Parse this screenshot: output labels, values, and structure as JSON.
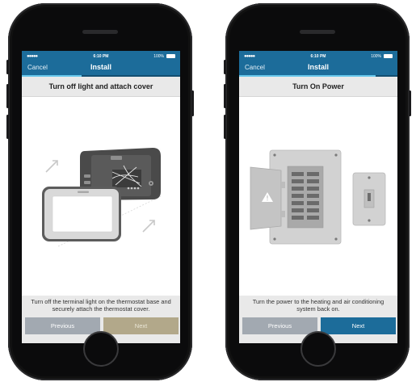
{
  "status_bar": {
    "signal": "●●●●●",
    "time": "6:10 PM",
    "battery": "100%"
  },
  "screens": [
    {
      "nav": {
        "cancel": "Cancel",
        "title": "Install"
      },
      "progress": 0.38,
      "step_title": "Turn off light and attach cover",
      "instruction": "Turn off the terminal light on the thermostat base and securely attach the thermostat cover.",
      "buttons": {
        "previous": "Previous",
        "next": "Next"
      },
      "illustration_icons": [
        "thermostat-base-icon",
        "thermostat-cover-icon",
        "arrow-icon"
      ],
      "next_state": "disabled"
    },
    {
      "nav": {
        "cancel": "Cancel",
        "title": "Install"
      },
      "progress": 0.86,
      "step_title": "Turn On Power",
      "instruction": "Turn the power to the heating and air conditioning system back on.",
      "buttons": {
        "previous": "Previous",
        "next": "Next"
      },
      "illustration_icons": [
        "breaker-panel-icon",
        "warning-icon",
        "light-switch-icon"
      ],
      "next_state": "enabled"
    }
  ],
  "colors": {
    "brand_blue": "#1c6c9a",
    "progress_accent": "#66c6ea",
    "previous_button": "#a2a9b1",
    "next_disabled": "#b2a88a",
    "next_enabled": "#1c6c9a"
  }
}
